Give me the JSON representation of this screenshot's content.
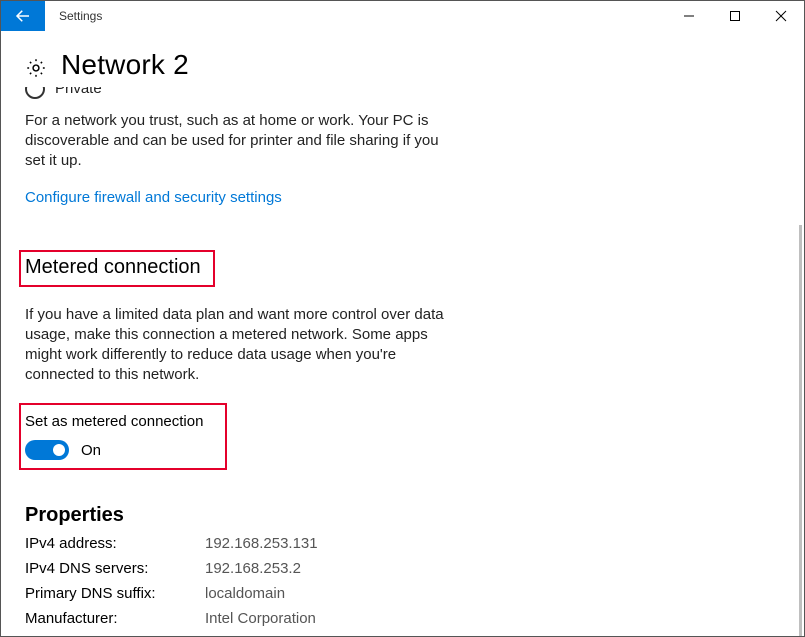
{
  "titlebar": {
    "app_name": "Settings"
  },
  "page": {
    "title": "Network  2"
  },
  "private_section": {
    "radio_label": "Private",
    "description": "For a network you trust, such as at home or work. Your PC is discoverable and can be used for printer and file sharing if you set it up."
  },
  "firewall_link": "Configure firewall and security settings",
  "metered": {
    "heading": "Metered connection",
    "description": "If you have a limited data plan and want more control over data usage, make this connection a metered network. Some apps might work differently to reduce data usage when you're connected to this network.",
    "toggle_label": "Set as metered connection",
    "toggle_state": "On"
  },
  "properties": {
    "heading": "Properties",
    "rows": [
      {
        "label": "IPv4 address:",
        "value": "192.168.253.131"
      },
      {
        "label": "IPv4 DNS servers:",
        "value": "192.168.253.2"
      },
      {
        "label": "Primary DNS suffix:",
        "value": "localdomain"
      },
      {
        "label": "Manufacturer:",
        "value": "Intel Corporation"
      }
    ]
  }
}
